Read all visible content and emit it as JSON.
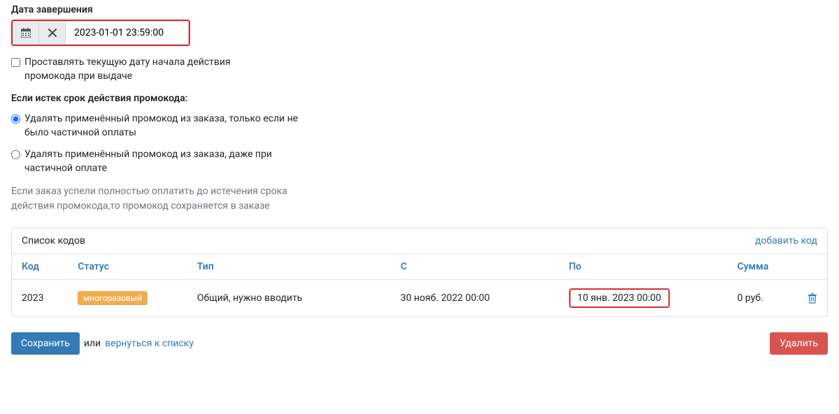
{
  "end_date": {
    "label": "Дата завершения",
    "value": "2023-01-01 23:59:00"
  },
  "checkbox": {
    "label": "Проставлять текущую дату начала действия промокода при выдаче"
  },
  "expired_section": {
    "label": "Если истек срок действия промокода:",
    "option1": "Удалять применённый промокод из заказа, только если не было частичной оплаты",
    "option2": "Удалять применённый промокод из заказа, даже при частичной оплате",
    "help": "Если заказ успели полностью оплатить до истечения срока действия промокода,то промокод сохраняется в заказе"
  },
  "codes_panel": {
    "title": "Список кодов",
    "add_link": "добавить код",
    "headers": {
      "code": "Код",
      "status": "Статус",
      "type": "Тип",
      "from": "С",
      "to": "По",
      "sum": "Сумма"
    },
    "row": {
      "code": "2023",
      "status_badge": "многоразовый",
      "type": "Общий, нужно вводить",
      "from": "30 нояб. 2022 00:00",
      "to": "10 янв. 2023 00:00",
      "sum": "0 руб."
    }
  },
  "footer": {
    "save": "Сохранить",
    "or": "или",
    "back_link": "вернуться к списку",
    "delete": "Удалить"
  }
}
